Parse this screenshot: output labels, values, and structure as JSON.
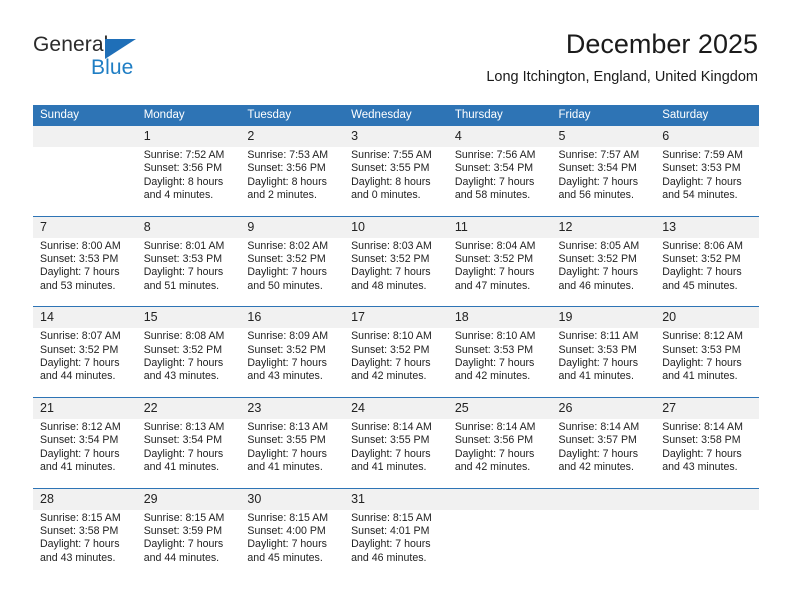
{
  "brand": {
    "name_top": "General",
    "name_bottom": "Blue",
    "accent_color": "#1f7ec4",
    "triangle_color": "#1f6fb8"
  },
  "header": {
    "title": "December 2025",
    "subtitle": "Long Itchington, England, United Kingdom"
  },
  "theme": {
    "header_blue": "#2e74b5",
    "daynum_band": "#f1f1f1",
    "text": "#222222"
  },
  "calendar": {
    "weekday_headers": [
      "Sunday",
      "Monday",
      "Tuesday",
      "Wednesday",
      "Thursday",
      "Friday",
      "Saturday"
    ],
    "weeks": [
      {
        "days": [
          {
            "num": "",
            "lines": []
          },
          {
            "num": "1",
            "lines": [
              "Sunrise: 7:52 AM",
              "Sunset: 3:56 PM",
              "Daylight: 8 hours",
              "and 4 minutes."
            ]
          },
          {
            "num": "2",
            "lines": [
              "Sunrise: 7:53 AM",
              "Sunset: 3:56 PM",
              "Daylight: 8 hours",
              "and 2 minutes."
            ]
          },
          {
            "num": "3",
            "lines": [
              "Sunrise: 7:55 AM",
              "Sunset: 3:55 PM",
              "Daylight: 8 hours",
              "and 0 minutes."
            ]
          },
          {
            "num": "4",
            "lines": [
              "Sunrise: 7:56 AM",
              "Sunset: 3:54 PM",
              "Daylight: 7 hours",
              "and 58 minutes."
            ]
          },
          {
            "num": "5",
            "lines": [
              "Sunrise: 7:57 AM",
              "Sunset: 3:54 PM",
              "Daylight: 7 hours",
              "and 56 minutes."
            ]
          },
          {
            "num": "6",
            "lines": [
              "Sunrise: 7:59 AM",
              "Sunset: 3:53 PM",
              "Daylight: 7 hours",
              "and 54 minutes."
            ]
          }
        ]
      },
      {
        "days": [
          {
            "num": "7",
            "lines": [
              "Sunrise: 8:00 AM",
              "Sunset: 3:53 PM",
              "Daylight: 7 hours",
              "and 53 minutes."
            ]
          },
          {
            "num": "8",
            "lines": [
              "Sunrise: 8:01 AM",
              "Sunset: 3:53 PM",
              "Daylight: 7 hours",
              "and 51 minutes."
            ]
          },
          {
            "num": "9",
            "lines": [
              "Sunrise: 8:02 AM",
              "Sunset: 3:52 PM",
              "Daylight: 7 hours",
              "and 50 minutes."
            ]
          },
          {
            "num": "10",
            "lines": [
              "Sunrise: 8:03 AM",
              "Sunset: 3:52 PM",
              "Daylight: 7 hours",
              "and 48 minutes."
            ]
          },
          {
            "num": "11",
            "lines": [
              "Sunrise: 8:04 AM",
              "Sunset: 3:52 PM",
              "Daylight: 7 hours",
              "and 47 minutes."
            ]
          },
          {
            "num": "12",
            "lines": [
              "Sunrise: 8:05 AM",
              "Sunset: 3:52 PM",
              "Daylight: 7 hours",
              "and 46 minutes."
            ]
          },
          {
            "num": "13",
            "lines": [
              "Sunrise: 8:06 AM",
              "Sunset: 3:52 PM",
              "Daylight: 7 hours",
              "and 45 minutes."
            ]
          }
        ]
      },
      {
        "days": [
          {
            "num": "14",
            "lines": [
              "Sunrise: 8:07 AM",
              "Sunset: 3:52 PM",
              "Daylight: 7 hours",
              "and 44 minutes."
            ]
          },
          {
            "num": "15",
            "lines": [
              "Sunrise: 8:08 AM",
              "Sunset: 3:52 PM",
              "Daylight: 7 hours",
              "and 43 minutes."
            ]
          },
          {
            "num": "16",
            "lines": [
              "Sunrise: 8:09 AM",
              "Sunset: 3:52 PM",
              "Daylight: 7 hours",
              "and 43 minutes."
            ]
          },
          {
            "num": "17",
            "lines": [
              "Sunrise: 8:10 AM",
              "Sunset: 3:52 PM",
              "Daylight: 7 hours",
              "and 42 minutes."
            ]
          },
          {
            "num": "18",
            "lines": [
              "Sunrise: 8:10 AM",
              "Sunset: 3:53 PM",
              "Daylight: 7 hours",
              "and 42 minutes."
            ]
          },
          {
            "num": "19",
            "lines": [
              "Sunrise: 8:11 AM",
              "Sunset: 3:53 PM",
              "Daylight: 7 hours",
              "and 41 minutes."
            ]
          },
          {
            "num": "20",
            "lines": [
              "Sunrise: 8:12 AM",
              "Sunset: 3:53 PM",
              "Daylight: 7 hours",
              "and 41 minutes."
            ]
          }
        ]
      },
      {
        "days": [
          {
            "num": "21",
            "lines": [
              "Sunrise: 8:12 AM",
              "Sunset: 3:54 PM",
              "Daylight: 7 hours",
              "and 41 minutes."
            ]
          },
          {
            "num": "22",
            "lines": [
              "Sunrise: 8:13 AM",
              "Sunset: 3:54 PM",
              "Daylight: 7 hours",
              "and 41 minutes."
            ]
          },
          {
            "num": "23",
            "lines": [
              "Sunrise: 8:13 AM",
              "Sunset: 3:55 PM",
              "Daylight: 7 hours",
              "and 41 minutes."
            ]
          },
          {
            "num": "24",
            "lines": [
              "Sunrise: 8:14 AM",
              "Sunset: 3:55 PM",
              "Daylight: 7 hours",
              "and 41 minutes."
            ]
          },
          {
            "num": "25",
            "lines": [
              "Sunrise: 8:14 AM",
              "Sunset: 3:56 PM",
              "Daylight: 7 hours",
              "and 42 minutes."
            ]
          },
          {
            "num": "26",
            "lines": [
              "Sunrise: 8:14 AM",
              "Sunset: 3:57 PM",
              "Daylight: 7 hours",
              "and 42 minutes."
            ]
          },
          {
            "num": "27",
            "lines": [
              "Sunrise: 8:14 AM",
              "Sunset: 3:58 PM",
              "Daylight: 7 hours",
              "and 43 minutes."
            ]
          }
        ]
      },
      {
        "days": [
          {
            "num": "28",
            "lines": [
              "Sunrise: 8:15 AM",
              "Sunset: 3:58 PM",
              "Daylight: 7 hours",
              "and 43 minutes."
            ]
          },
          {
            "num": "29",
            "lines": [
              "Sunrise: 8:15 AM",
              "Sunset: 3:59 PM",
              "Daylight: 7 hours",
              "and 44 minutes."
            ]
          },
          {
            "num": "30",
            "lines": [
              "Sunrise: 8:15 AM",
              "Sunset: 4:00 PM",
              "Daylight: 7 hours",
              "and 45 minutes."
            ]
          },
          {
            "num": "31",
            "lines": [
              "Sunrise: 8:15 AM",
              "Sunset: 4:01 PM",
              "Daylight: 7 hours",
              "and 46 minutes."
            ]
          },
          {
            "num": "",
            "lines": []
          },
          {
            "num": "",
            "lines": []
          },
          {
            "num": "",
            "lines": []
          }
        ]
      }
    ]
  }
}
